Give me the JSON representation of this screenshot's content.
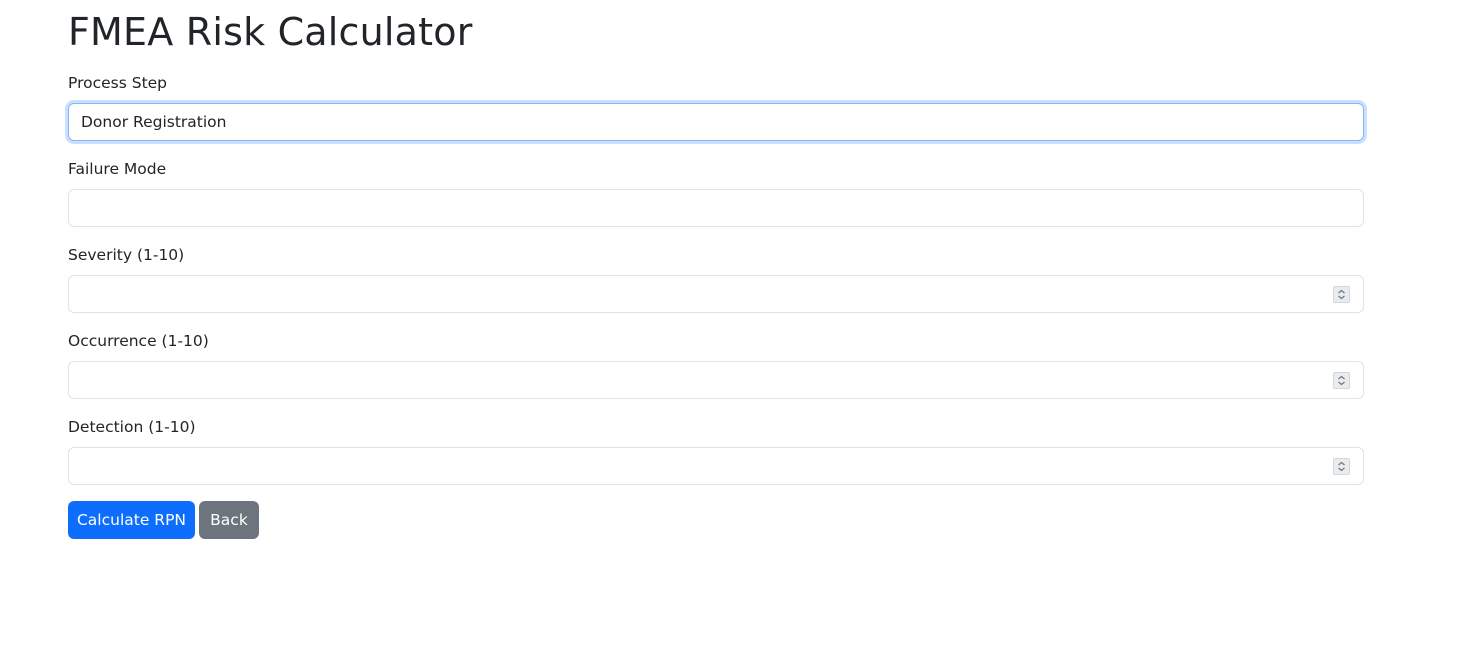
{
  "page": {
    "title": "FMEA Risk Calculator"
  },
  "form": {
    "process_step": {
      "label": "Process Step",
      "value": "Donor Registration"
    },
    "failure_mode": {
      "label": "Failure Mode",
      "value": ""
    },
    "severity": {
      "label": "Severity (1-10)",
      "value": ""
    },
    "occurrence": {
      "label": "Occurrence (1-10)",
      "value": ""
    },
    "detection": {
      "label": "Detection (1-10)",
      "value": ""
    }
  },
  "buttons": {
    "calculate_label": "Calculate RPN",
    "back_label": "Back"
  },
  "colors": {
    "primary": "#0d6efd",
    "secondary": "#6c757d",
    "focus_border": "#86b7fe"
  },
  "icons": {
    "spinner": "number-spinner-icon"
  }
}
